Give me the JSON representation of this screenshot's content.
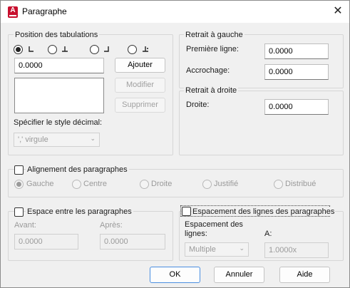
{
  "window": {
    "title": "Paragraphe",
    "close_glyph": "✕"
  },
  "tabs_section": {
    "title": "Position des tabulations",
    "tab_types": [
      "left-tab",
      "center-tab",
      "right-tab",
      "decimal-tab"
    ],
    "position_value": "0.0000",
    "add_label": "Ajouter",
    "modify_label": "Modifier",
    "delete_label": "Supprimer",
    "decimal_label": "Spécifier le style décimal:",
    "decimal_value": "',' virgule"
  },
  "left_indent": {
    "title": "Retrait à gauche",
    "first_line_label": "Première ligne:",
    "first_line_value": "0.0000",
    "hanging_label": "Accrochage:",
    "hanging_value": "0.0000"
  },
  "right_indent": {
    "title": "Retrait à droite",
    "right_label": "Droite:",
    "right_value": "0.0000"
  },
  "alignment": {
    "checkbox_label": "Alignement des paragraphes",
    "options": [
      "Gauche",
      "Centre",
      "Droite",
      "Justifié",
      "Distribué"
    ]
  },
  "spacing": {
    "checkbox_label": "Espace entre les paragraphes",
    "before_label": "Avant:",
    "before_value": "0.0000",
    "after_label": "Après:",
    "after_value": "0.0000"
  },
  "line_spacing": {
    "checkbox_label": "Espacement des lignes des paragraphes",
    "spacing_label_line1": "Espacement des",
    "spacing_label_line2": "lignes:",
    "spacing_value": "Multiple",
    "at_label": "A:",
    "at_value": "1.0000x"
  },
  "footer": {
    "ok_label": "OK",
    "cancel_label": "Annuler",
    "help_label": "Aide"
  }
}
